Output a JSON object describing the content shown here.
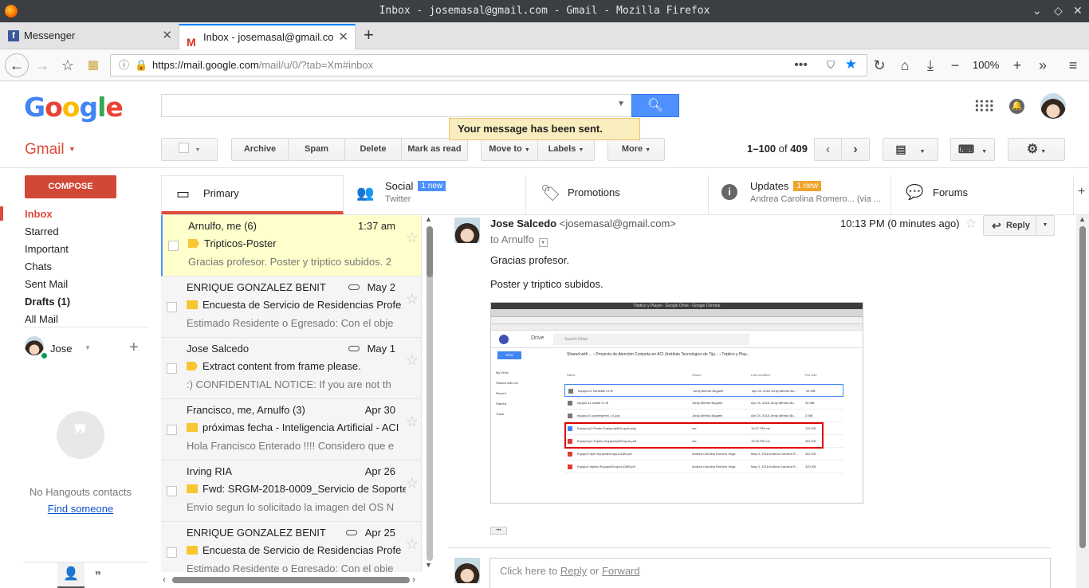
{
  "window": {
    "title": "Inbox - josemasal@gmail.com - Gmail - Mozilla Firefox"
  },
  "browser": {
    "tabs": [
      {
        "label": "Messenger"
      },
      {
        "label": "Inbox - josemasal@gmail.co"
      }
    ],
    "url_host": "https://mail.google.com",
    "url_path": "/mail/u/0/?tab=Xm#inbox",
    "zoom": "100%"
  },
  "gmail": {
    "logo_letters": [
      "G",
      "o",
      "o",
      "g",
      "l",
      "e"
    ],
    "logo_colors": [
      "#4285f4",
      "#ea4335",
      "#fbbc05",
      "#4285f4",
      "#34a853",
      "#ea4335"
    ],
    "app_label": "Gmail",
    "notice": "Your message has been sent.",
    "toolbar": {
      "archive": "Archive",
      "spam": "Spam",
      "delete": "Delete",
      "mark_read": "Mark as read",
      "move_to": "Move to",
      "labels": "Labels",
      "more": "More",
      "range": "1–100",
      "of": "of",
      "total": "409"
    },
    "compose": "COMPOSE",
    "nav": [
      {
        "label": "Inbox",
        "active": true,
        "bold": true
      },
      {
        "label": "Starred"
      },
      {
        "label": "Important"
      },
      {
        "label": "Chats"
      },
      {
        "label": "Sent Mail"
      },
      {
        "label": "Drafts (1)",
        "bold": true
      },
      {
        "label": "All Mail"
      }
    ],
    "user": "Jose",
    "hangouts": {
      "empty": "No Hangouts contacts",
      "find": "Find someone"
    },
    "categories": [
      {
        "label": "Primary"
      },
      {
        "label": "Social",
        "badge": "1 new",
        "badge_color": "#4d90fe",
        "sub": "Twitter"
      },
      {
        "label": "Promotions"
      },
      {
        "label": "Updates",
        "badge": "1 new",
        "badge_color": "#f1a42a",
        "sub": "Andrea Carolina Romero... (via ..."
      },
      {
        "label": "Forums"
      }
    ],
    "messages": [
      {
        "from": "Arnulfo, me (6)",
        "date": "1:37 am",
        "subject": "Tripticos-Poster",
        "snippet": "Gracias profesor. Poster y triptico subidos. 2",
        "clip": false,
        "important": true,
        "selected": true
      },
      {
        "from": "ENRIQUE GONZALEZ BENIT",
        "date": "May 2",
        "subject": "Encuesta de Servicio de Residencias Profe",
        "snippet": "Estimado Residente o Egresado: Con el obje",
        "clip": true,
        "important": false
      },
      {
        "from": "Jose Salcedo",
        "date": "May 1",
        "subject": "Extract content from frame please.",
        "snippet": ":) CONFIDENTIAL NOTICE: If you are not th",
        "clip": true,
        "important": true
      },
      {
        "from": "Francisco, me, Arnulfo (3)",
        "date": "Apr 30",
        "subject": "próximas fecha - Inteligencia Artificial - ACI",
        "snippet": "Hola Francisco Enterado !!!! Considero que e",
        "clip": false,
        "important": false
      },
      {
        "from": "Irving RIA",
        "date": "Apr 26",
        "subject": "Fwd: SRGM-2018-0009_Servicio de Soporte",
        "snippet": "Envío segun lo solicitado la imagen del OS N",
        "clip": false,
        "important": false
      },
      {
        "from": "ENRIQUE GONZALEZ BENIT",
        "date": "Apr 25",
        "subject": "Encuesta de Servicio de Residencias Profe",
        "snippet": "Estimado Residente o Egresado: Con el obje",
        "clip": true,
        "important": false
      }
    ],
    "open_message": {
      "sender": "Jose Salcedo",
      "sender_email": "<josemasal@gmail.com>",
      "time": "10:13 PM (0 minutes ago)",
      "to_prefix": "to",
      "to": "Arnulfo",
      "reply": "Reply",
      "body": [
        "Gracias profesor.",
        "Poster y triptico subidos."
      ],
      "ellipsis": "•••",
      "reply_box_prefix": "Click here to",
      "reply_link": "Reply",
      "reply_or": "or",
      "forward_link": "Forward"
    },
    "attachment_image": {
      "title": "Triptico y Player - Google Drive - Google Chrome",
      "drive": "Drive",
      "search": "Search Drive",
      "new_button": "NEW",
      "breadcrumb": "Shared with ... › Proyecto de Atención Conjunta en ACI (Instituto Tecnologico de Tiju... › Triptico y Play...",
      "side_items": [
        "My Drive",
        "Shared with me",
        "Recent",
        "Starred",
        "Trash"
      ],
      "columns": [
        "Name",
        "Owner",
        "Last modified",
        "File size"
      ],
      "files": [
        {
          "name": "equipo b1 frontside v1.tif",
          "owner": "Jordy Alfredo Bugarin",
          "mod": "Apr 24, 2018 Jordy Alfredo Bu...",
          "size": "34 MB",
          "hl": false
        },
        {
          "name": "equipo b1 inside v1.tif",
          "owner": "Jordy Alfredo Bugarin",
          "mod": "Apr 24, 2018 Jordy Alfredo Bu...",
          "size": "34 MB",
          "hl": false
        },
        {
          "name": "equipo b1 postergreen_v1.jpg",
          "owner": "Jordy Alfredo Bugarin",
          "mod": "Apr 24, 2018 Jordy Alfredo Bu...",
          "size": "3 MB",
          "hl": false
        },
        {
          "name": "Equipo1y2-Poster-Equipo4y8GrupoA.png",
          "owner": "me",
          "mod": "10:07 PM me",
          "size": "192 KB",
          "hl": true
        },
        {
          "name": "Equipo1y2-Triptico-Equipo4y8GrupoA.pdf",
          "owner": "me",
          "mod": "10:09 PM me",
          "size": "382 KB",
          "hl": true
        },
        {
          "name": "Equipo2 flyer Equipo8Grupo1418B.pdf",
          "owner": "Andrea Carolina Romero Vega",
          "mod": "May 3, 2018 Andrea Carolina R...",
          "size": "264 KB",
          "hl": false
        },
        {
          "name": "Equipo2 triptico Equipo8Grupo1418B.pdf",
          "owner": "Andrea Carolina Romero Vega",
          "mod": "May 3, 2018 Andrea Carolina R...",
          "size": "320 KB",
          "hl": false
        }
      ]
    }
  }
}
